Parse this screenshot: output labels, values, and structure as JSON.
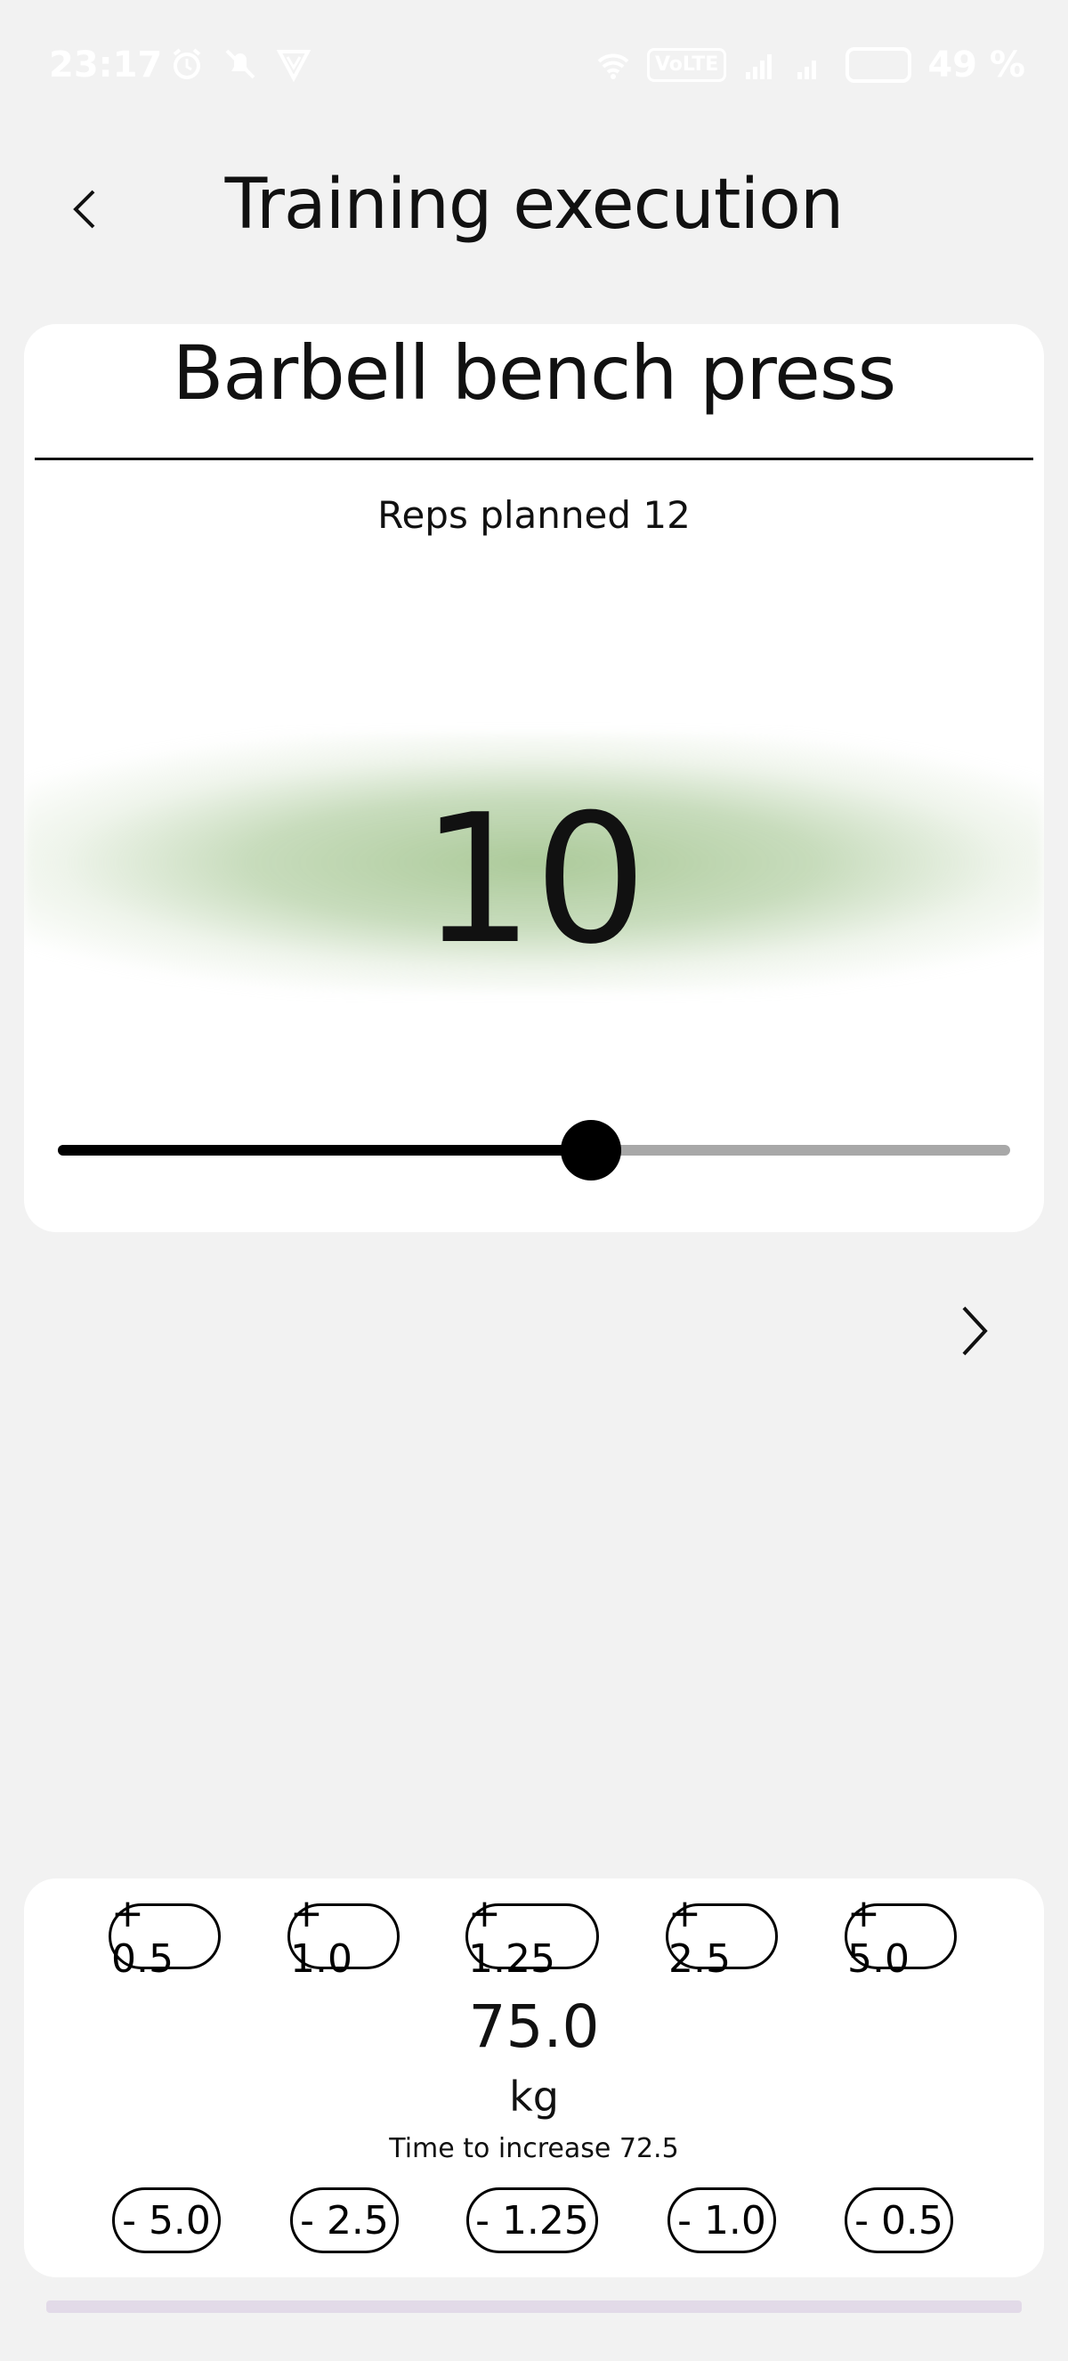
{
  "status_bar": {
    "time": "23:17",
    "left_icons": [
      "alarm-icon",
      "mute-icon",
      "vpn-icon"
    ],
    "network_badge": "VoLTE",
    "battery": "49 %"
  },
  "header": {
    "back_icon": "chevron-left-icon",
    "title": "Training execution"
  },
  "exercise": {
    "name": "Barbell bench press",
    "reps_planned_label": "Reps planned 12",
    "reps_value": "10",
    "slider": {
      "value": 10,
      "max": 18,
      "fraction": 0.56
    },
    "accent_color": "#9ec189"
  },
  "navigation": {
    "next_icon": "chevron-right-icon"
  },
  "weight": {
    "increase_buttons": [
      "+ 0.5",
      "+ 1.0",
      "+ 1.25",
      "+ 2.5",
      "+ 5.0"
    ],
    "decrease_buttons": [
      "- 5.0",
      "- 2.5",
      "- 1.25",
      "- 1.0",
      "- 0.5"
    ],
    "value": "75.0",
    "unit": "kg",
    "hint": "Time to increase 72.5"
  }
}
